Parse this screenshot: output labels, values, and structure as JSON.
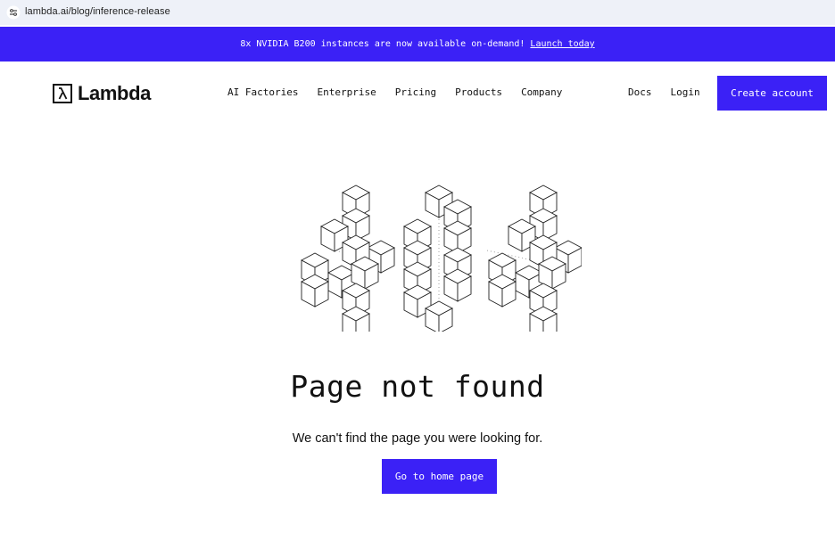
{
  "colors": {
    "accent": "#3b21f6"
  },
  "browser": {
    "url": "lambda.ai/blog/inference-release",
    "site_icon": "tune-icon"
  },
  "banner": {
    "text": "8x NVIDIA B200 instances are now available on-demand!",
    "link": "Launch today"
  },
  "header": {
    "logo_icon": "lambda-symbol-icon",
    "logo_text": "Lambda",
    "nav": [
      "AI Factories",
      "Enterprise",
      "Pricing",
      "Products",
      "Company"
    ],
    "docs": "Docs",
    "login": "Login",
    "cta": "Create account"
  },
  "illustration": {
    "icon": "cube-stack-illustration"
  },
  "error": {
    "title": "Page not found",
    "message": "We can't find the page you were looking for.",
    "button": "Go to home page"
  }
}
